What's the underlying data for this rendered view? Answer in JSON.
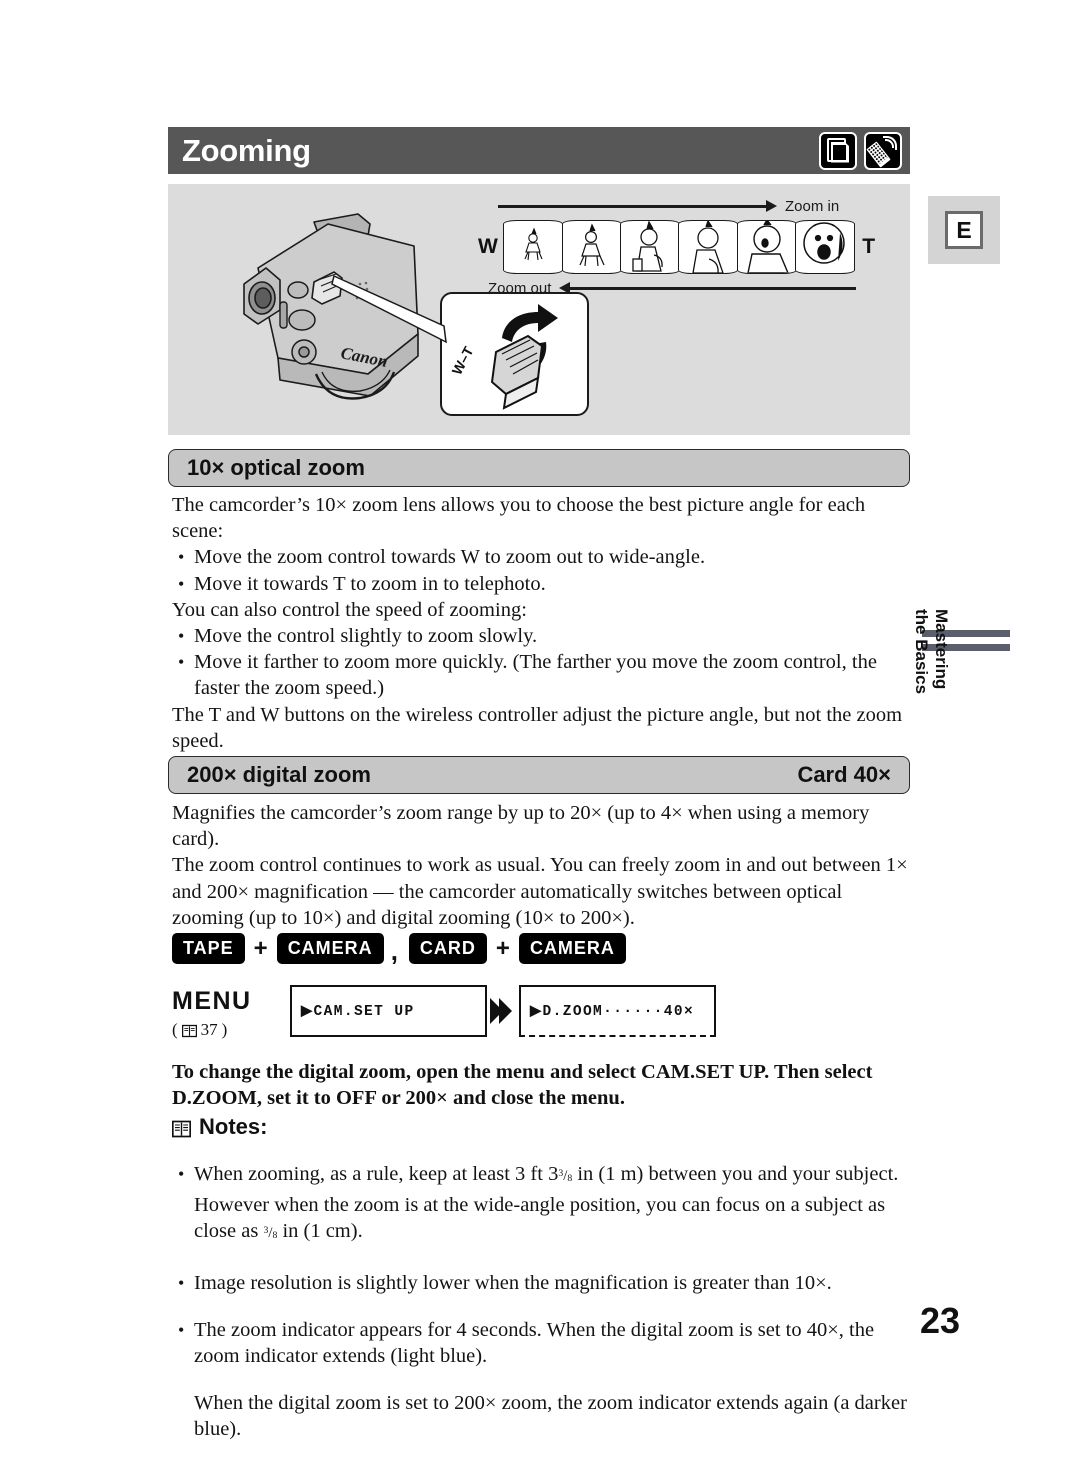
{
  "page": {
    "number": "23",
    "language_tab": "E",
    "side_tab_line1": "Mastering",
    "side_tab_line2": "the Basics"
  },
  "header": {
    "title": "Zooming",
    "icons": [
      "memory-card-icon",
      "wireless-remote-icon"
    ]
  },
  "illustration": {
    "zoom_in_label": "Zoom in",
    "zoom_out_label": "Zoom out",
    "wide_label": "W",
    "tele_label": "T",
    "control_label": "W–T",
    "camcorder_brand": "Canon",
    "frame_count": 6
  },
  "sections": [
    {
      "heading_left": "10× optical zoom",
      "heading_right": "",
      "paragraphs": [
        {
          "type": "text",
          "text": "The camcorder’s 10× zoom lens allows you to choose the best picture angle for each scene:"
        },
        {
          "type": "bullet",
          "text": "Move the zoom control towards W to zoom out to wide-angle."
        },
        {
          "type": "bullet",
          "text": "Move it towards T to zoom in to telephoto."
        },
        {
          "type": "text",
          "text": "You can also control the speed of zooming:"
        },
        {
          "type": "bullet",
          "text": "Move the control slightly to zoom slowly."
        },
        {
          "type": "bullet",
          "text": "Move it farther to zoom more quickly. (The farther you move the zoom control, the faster the zoom speed.)"
        },
        {
          "type": "text",
          "text": "The T and W buttons on the wireless controller adjust the picture angle, but not the zoom speed."
        }
      ]
    },
    {
      "heading_left": "200× digital zoom",
      "heading_right": "Card 40×",
      "paragraphs": [
        {
          "type": "text",
          "text": "Magnifies the camcorder’s zoom range by up to 20× (up to 4× when using a memory card)."
        },
        {
          "type": "text",
          "text": "The zoom control continues to work as usual. You can freely zoom in and out between 1× and 200× magnification — the camcorder automatically switches between optical zooming (up to 10×) and digital zooming (10× to 200×)."
        }
      ]
    }
  ],
  "mode_badges": {
    "tape": "TAPE",
    "camera_1": "CAMERA",
    "plus_1": "+",
    "separator": ",",
    "card": "CARD",
    "camera_2": "CAMERA",
    "plus_2": "+"
  },
  "menu": {
    "label": "MENU",
    "reference_prefix": "(",
    "reference_page": "37",
    "reference_suffix": ")",
    "step_1": "▶CAM.SET UP",
    "step_2": "▶D.ZOOM······40×"
  },
  "instruction": "To change the digital zoom, open the menu and select CAM.SET UP. Then select D.ZOOM, set it to OFF or 200× and close the menu.",
  "notes": {
    "heading": "Notes:",
    "icon": "book-icon",
    "items": [
      "When zooming, as a rule, keep at least 3 ft 3@FRAC@ in (1 m) between you and your subject. However when the zoom is at the wide-angle position, you can focus on a subject as close as @FRAC2@ in (1 cm).",
      "Image resolution is slightly lower when the magnification is greater than 10×.",
      "The zoom indicator appears for 4 seconds. When the digital zoom is set to 40×, the zoom indicator extends (light blue).",
      "When the digital zoom is set to 200× zoom, the zoom indicator extends again (a darker blue)."
    ],
    "fraction": "3/8"
  },
  "colors": {
    "header_bar": "#575757",
    "illustration_bg": "#dcdcdc",
    "section_head_bg": "#c6c6c6",
    "tab_bg": "#d4d4d4",
    "side_rule": "#5b5f6b",
    "ink": "#111111"
  }
}
